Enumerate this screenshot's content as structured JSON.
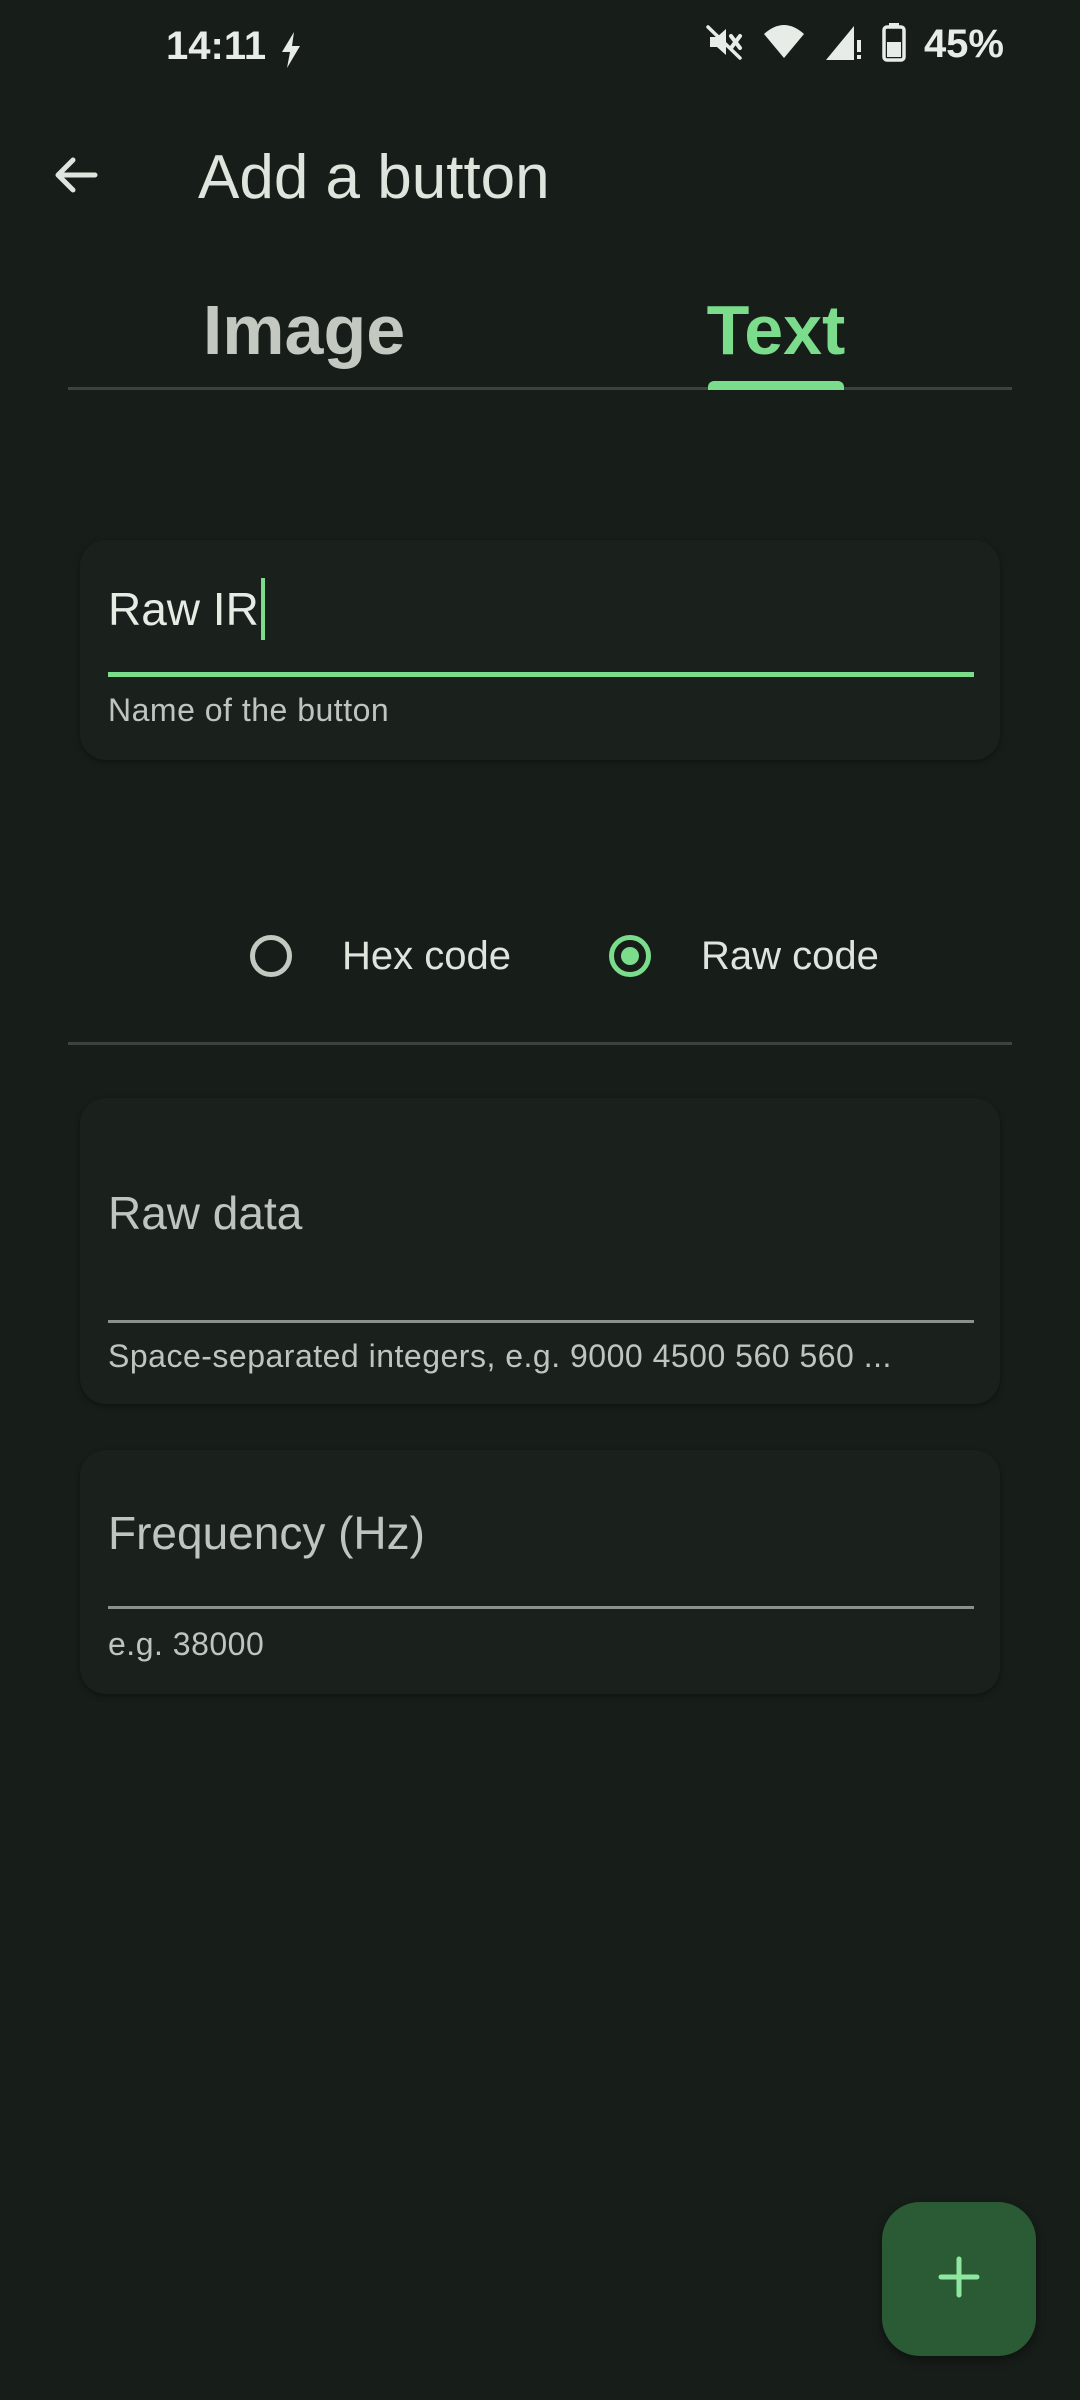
{
  "status_bar": {
    "time": "14:11",
    "battery": "45%",
    "icons": [
      "flash-icon",
      "mute-icon",
      "wifi-icon",
      "signal-icon",
      "battery-icon"
    ]
  },
  "app_bar": {
    "title": "Add a button",
    "back_icon": "arrow-back-icon"
  },
  "tabs": [
    {
      "label": "Image",
      "selected": false
    },
    {
      "label": "Text",
      "selected": true
    }
  ],
  "name_field": {
    "value": "Raw IR",
    "helper": "Name of the button"
  },
  "code_type": {
    "options": [
      {
        "label": "Hex code",
        "selected": false
      },
      {
        "label": "Raw code",
        "selected": true
      }
    ]
  },
  "raw_data_field": {
    "label": "Raw data",
    "helper": "Space-separated integers, e.g. 9000 4500 560 560 ..."
  },
  "frequency_field": {
    "label": "Frequency (Hz)",
    "helper": "e.g. 38000"
  },
  "fab": {
    "icon": "plus-icon"
  },
  "colors": {
    "background": "#171d19",
    "accent": "#7bdc8c",
    "fab": "#2a5b35"
  }
}
